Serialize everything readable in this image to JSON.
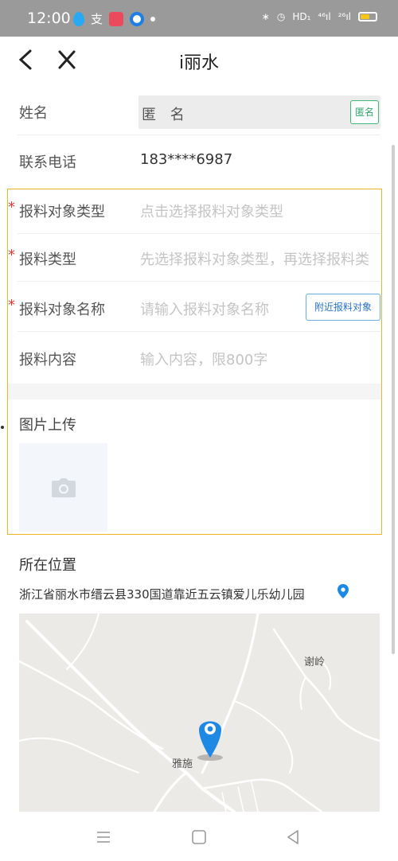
{
  "status_bar": {
    "time": "12:00",
    "left_icons": [
      "water-drop-icon",
      "app-icon",
      "heart-app-icon",
      "circle-app-icon",
      "dot-icon"
    ],
    "app_char": "支",
    "right_icons": [
      "bluetooth-icon",
      "alarm-icon",
      "hd-icon",
      "signal-icon",
      "signal-icon",
      "battery-icon"
    ],
    "right_texts": [
      "∗",
      "◷",
      "HD₁",
      "⁴⁶ıl",
      "²⁶ıl"
    ]
  },
  "nav": {
    "title": "i丽水"
  },
  "form": {
    "name_label": "姓名",
    "name_value": "匿 名",
    "anon_button": "匿名",
    "phone_label": "联系电话",
    "phone_value": "183****6987",
    "target_type_label": "报料对象类型",
    "target_type_placeholder": "点击选择报料对象类型",
    "report_type_label": "报料类型",
    "report_type_placeholder": "先选择报料对象类型，再选择报料类",
    "target_name_label": "报料对象名称",
    "target_name_placeholder": "请输入报料对象名称",
    "nearby_button": "附近报料对象",
    "content_label": "报料内容",
    "content_placeholder": "输入内容，限800字",
    "required_mark": "*"
  },
  "upload": {
    "label": "图片上传"
  },
  "location": {
    "label": "所在位置",
    "address": "浙江省丽水市缙云县330国道靠近五云镇爱儿乐幼儿园",
    "map_labels": [
      "谢岭",
      "雅施"
    ]
  },
  "bottom_nav": [
    "menu-icon",
    "home-square-icon",
    "back-triangle-icon"
  ],
  "colors": {
    "accent_green": "#2aa96a",
    "required_red": "#e53935",
    "frame_orange": "#f0b323",
    "pin_blue": "#1e88e5"
  }
}
